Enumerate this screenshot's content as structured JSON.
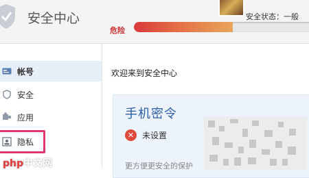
{
  "header": {
    "title": "安全中心",
    "security_status_label": "安全状态：一般",
    "danger_label": "危险",
    "security_level_fraction": 0.55
  },
  "sidebar": {
    "items": [
      {
        "label": "帐号",
        "icon": "card-icon",
        "active": true
      },
      {
        "label": "安全",
        "icon": "shield-icon",
        "active": false
      },
      {
        "label": "应用",
        "icon": "puzzle-icon",
        "active": false
      },
      {
        "label": "隐私",
        "icon": "photo-icon",
        "active": false
      }
    ]
  },
  "main": {
    "welcome": "欢迎来到安全中心",
    "card": {
      "title": "手机密令",
      "status": "未设置",
      "description": "更方便更安全的保护"
    }
  },
  "watermark": {
    "prefix": "php",
    "suffix": "中文网"
  },
  "colors": {
    "accent_blue": "#2c5ea8",
    "danger_red": "#d43030",
    "highlight_pink": "#e2356d"
  }
}
